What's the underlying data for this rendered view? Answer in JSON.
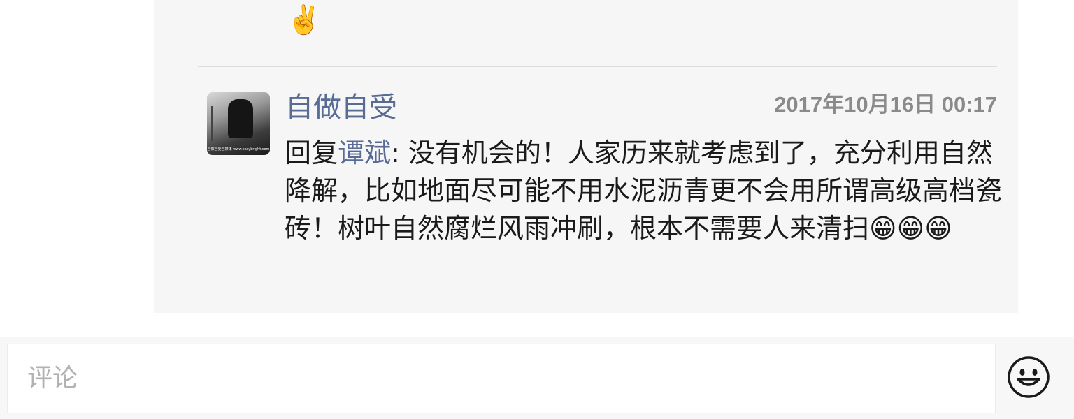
{
  "previous_comment": {
    "emoji": "✌️"
  },
  "comment": {
    "author": "自做自受",
    "timestamp": "2017年10月16日 00:17",
    "reply_prefix": "回复",
    "reply_target": "谭斌",
    "text": ": 没有机会的！人家历来就考虑到了，充分利用自然降解，比如地面尽可能不用水泥沥青更不会用所谓高级高档瓷砖！树叶自然腐烂风雨冲刷，根本不需要人来清扫",
    "emojis": [
      "😁",
      "😁",
      "😁"
    ],
    "avatar_caption": "自做自受自媒体 www.easybright.com"
  },
  "input_bar": {
    "placeholder": "评论",
    "emoji_button_icon": "smiley-face-icon"
  },
  "colors": {
    "link": "#576b95",
    "panel_bg": "#f6f6f6",
    "timestamp": "#8a8a8a",
    "placeholder": "#b2b2b2"
  }
}
